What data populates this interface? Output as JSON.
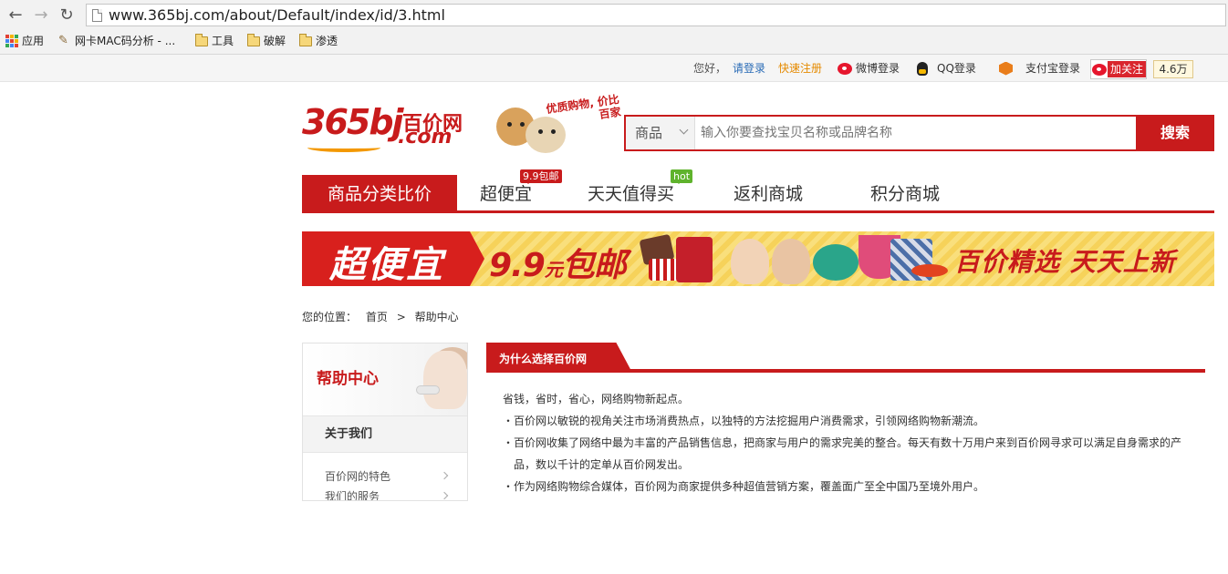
{
  "browser": {
    "url": "www.365bj.com/about/Default/index/id/3.html",
    "bookmarks": [
      "应用",
      "网卡MAC码分析 - ...",
      "工具",
      "破解",
      "渗透"
    ]
  },
  "topbar": {
    "greeting": "您好，",
    "login": "请登录",
    "register": "快速注册",
    "weibo_login": "微博登录",
    "qq_login": "QQ登录",
    "alipay_login": "支付宝登录",
    "follow": "加关注",
    "fans": "4.6万"
  },
  "logo": {
    "brand_num": "365bj",
    "brand_cn": "百价网",
    "brand_com": ".com",
    "slogan": "优质购物, 价比百家"
  },
  "search": {
    "category": "商品",
    "placeholder": "输入你要查找宝贝名称或品牌名称",
    "button": "搜索"
  },
  "nav": {
    "items": [
      "商品分类比价",
      "超便宜",
      "天天值得买",
      "返利商城",
      "积分商城"
    ],
    "badge_cheap": "9.9包邮",
    "badge_hot": "hot"
  },
  "banner": {
    "left": "超便宜",
    "price": "9.9",
    "price_unit": "元",
    "price_suffix": "包邮",
    "right": "百价精选 天天上新"
  },
  "breadcrumb": {
    "label": "您的位置：",
    "home": "首页",
    "sep": ">",
    "current": "帮助中心"
  },
  "sidebar": {
    "title": "帮助中心",
    "section": "关于我们",
    "items": [
      "百价网的特色",
      "我们的服务"
    ]
  },
  "content": {
    "title": "为什么选择百价网",
    "paragraphs": [
      "省钱，省时，省心，网络购物新起点。",
      "・百价网以敏锐的视角关注市场消费热点，以独特的方法挖掘用户消费需求，引领网络购物新潮流。",
      "・百价网收集了网络中最为丰富的产品销售信息，把商家与用户的需求完美的整合。每天有数十万用户来到百价网寻求可以满足自身需求的产",
      "品，数以千计的定单从百价网发出。",
      "・作为网络购物综合媒体，百价网为商家提供多种超值营销方案，覆盖面广至全中国乃至境外用户。"
    ]
  },
  "colors": {
    "brand_red": "#c81b1c",
    "hot_green": "#5fb32c",
    "link_blue": "#2a6cb6",
    "register_orange": "#e58a00"
  }
}
